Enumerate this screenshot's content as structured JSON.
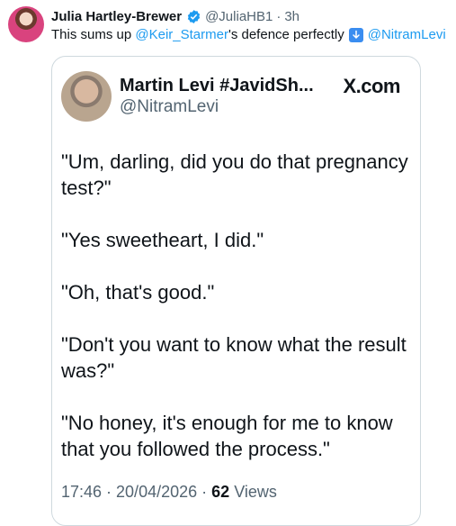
{
  "tweet": {
    "display_name": "Julia Hartley-Brewer",
    "handle": "@JuliaHB1",
    "separator": "·",
    "time": "3h",
    "text_prefix": "This sums up",
    "mention_1": "@Keir_Starmer",
    "text_middle": "'s defence perfectly",
    "mention_2": "@NitramLevi",
    "arrow_icon": "down-arrow-emoji"
  },
  "quote": {
    "display_name": "Martin Levi #JavidSh...",
    "handle": "@NitramLevi",
    "brand": "X.com",
    "lines": [
      "\"Um, darling, did you do that pregnancy\ntest?\"",
      "\"Yes sweetheart, I did.\"",
      "\"Oh, that's good.\"",
      "\"Don't you want to know what the result\nwas?\"",
      "\"No honey, it's enough for me to know\nthat you followed the process.\""
    ],
    "timestamp": "17:46 · 20/04/2026 ·",
    "views_count": "62",
    "views_label": "Views"
  },
  "colors": {
    "link": "#1d9bf0",
    "secondary_text": "#536471",
    "verified": "#1d9bf0"
  }
}
